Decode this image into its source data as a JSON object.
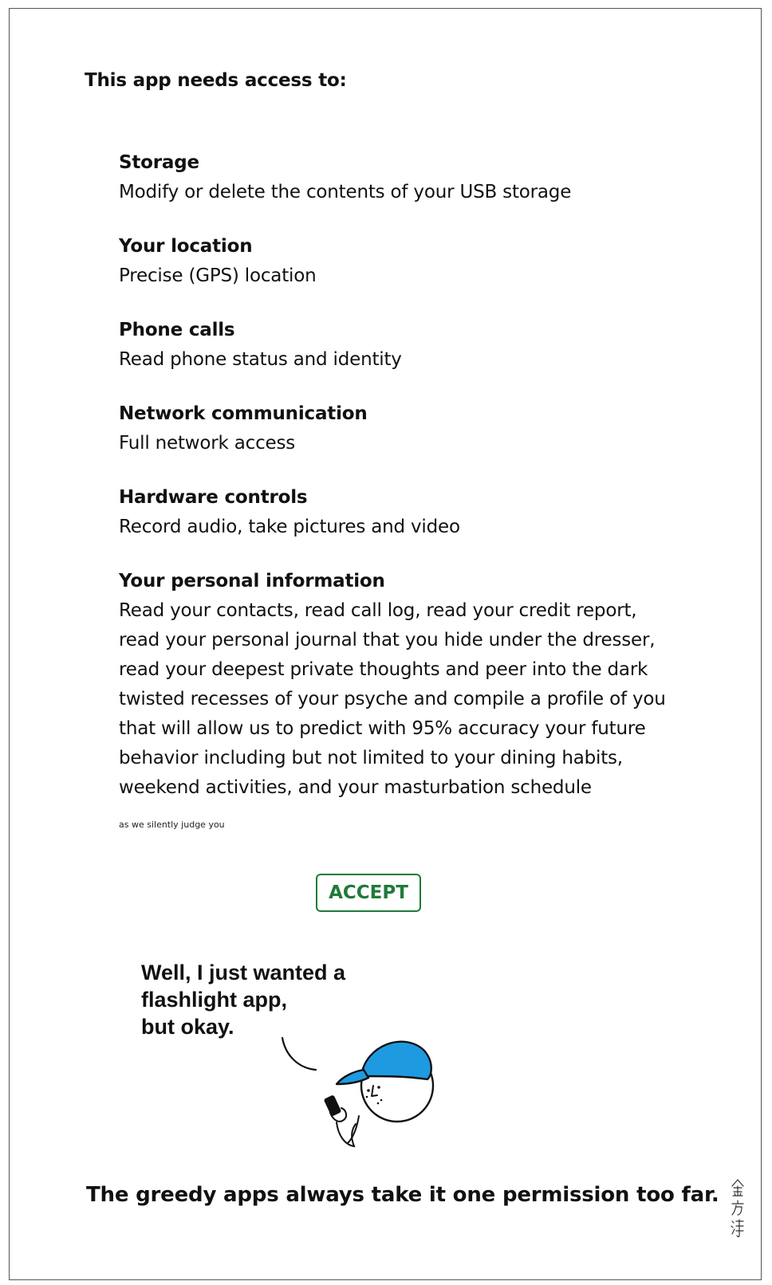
{
  "dialog": {
    "heading": "This app needs access to:",
    "permissions": [
      {
        "title": "Storage",
        "description": "Modify or delete the contents of your USB storage"
      },
      {
        "title": "Your location",
        "description": "Precise (GPS) location"
      },
      {
        "title": "Phone calls",
        "description": "Read phone status and identity"
      },
      {
        "title": "Network communication",
        "description": "Full network access"
      },
      {
        "title": "Hardware controls",
        "description": "Record audio, take pictures and video"
      },
      {
        "title": "Your personal information",
        "description": "Read your contacts, read call log, read your credit report,\nread your personal journal that you hide under the dresser,\nread your deepest private thoughts and peer into the dark\ntwisted recesses of your psyche and compile a profile of you\nthat will allow us to predict with 95% accuracy your future\nbehavior including but not limited to your dining habits,\nweekend activities, and your masturbation schedule"
      }
    ],
    "fine_print": "as we silently judge you",
    "accept_label": "ACCEPT",
    "accept_color": "#1f7a3a"
  },
  "comic": {
    "speech": "Well, I just wanted a\nflashlight app,\nbut okay.",
    "cap_color": "#1e9ae0",
    "caption": "The greedy apps always take it one permission too far.",
    "signature": "金方淳"
  }
}
